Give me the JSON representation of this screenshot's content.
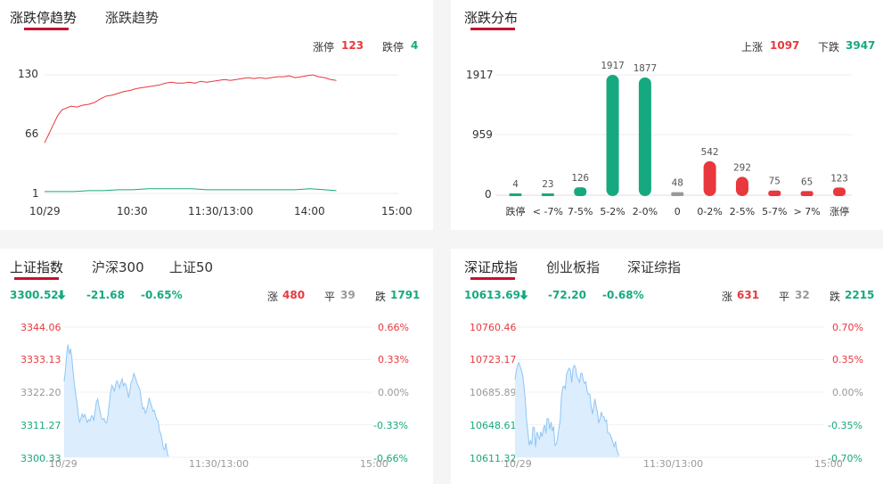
{
  "colors": {
    "up": "#e8383d",
    "down": "#16a97f",
    "flat": "#999999",
    "accent": "#c8102e",
    "area": "#dbeeff",
    "line": "#8fc6f5"
  },
  "limit_panel": {
    "tabs": [
      "涨跌停趋势",
      "涨跌趋势"
    ],
    "up_label": "涨停",
    "up_value": "123",
    "down_label": "跌停",
    "down_value": "4",
    "y_ticks": [
      "130",
      "66",
      "1"
    ],
    "x_ticks": [
      "10/29",
      "10:30",
      "11:30/13:00",
      "14:00",
      "15:00"
    ]
  },
  "dist_panel": {
    "tab": "涨跌分布",
    "up_label": "上涨",
    "up_value": "1097",
    "down_label": "下跌",
    "down_value": "3947",
    "y_ticks": [
      "1917",
      "959",
      "0"
    ]
  },
  "sh_panel": {
    "tabs": [
      "上证指数",
      "沪深300",
      "上证50"
    ],
    "price": "3300.52",
    "arrow_icon": "down-arrow-icon",
    "change": "-21.68",
    "pct": "-0.65%",
    "up_label": "涨",
    "up_value": "480",
    "flat_label": "平",
    "flat_value": "39",
    "down_label": "跌",
    "down_value": "1791",
    "y_left": [
      "3344.06",
      "3333.13",
      "3322.20",
      "3311.27",
      "3300.33"
    ],
    "y_right": [
      "0.66%",
      "0.33%",
      "0.00%",
      "-0.33%",
      "-0.66%"
    ],
    "x_ticks": [
      "10/29",
      "11:30/13:00",
      "15:00"
    ]
  },
  "sz_panel": {
    "tabs": [
      "深证成指",
      "创业板指",
      "深证综指"
    ],
    "price": "10613.69",
    "arrow_icon": "down-arrow-icon",
    "change": "-72.20",
    "pct": "-0.68%",
    "up_label": "涨",
    "up_value": "631",
    "flat_label": "平",
    "flat_value": "32",
    "down_label": "跌",
    "down_value": "2215",
    "y_left": [
      "10760.46",
      "10723.17",
      "10685.89",
      "10648.61",
      "10611.32"
    ],
    "y_right": [
      "0.70%",
      "0.35%",
      "0.00%",
      "-0.35%",
      "-0.70%"
    ],
    "x_ticks": [
      "10/29",
      "11:30/13:00",
      "15:00"
    ]
  },
  "chart_data": [
    {
      "type": "line",
      "name": "limit-trend",
      "y_range": [
        1,
        130
      ],
      "x_range": [
        0,
        240
      ],
      "series": [
        {
          "color": "#e8383d",
          "points": [
            [
              0,
              56
            ],
            [
              3,
              66
            ],
            [
              6,
              76
            ],
            [
              9,
              86
            ],
            [
              12,
              92
            ],
            [
              15,
              94
            ],
            [
              18,
              96
            ],
            [
              22,
              95
            ],
            [
              26,
              97
            ],
            [
              30,
              98
            ],
            [
              34,
              100
            ],
            [
              38,
              104
            ],
            [
              42,
              107
            ],
            [
              46,
              108
            ],
            [
              50,
              110
            ],
            [
              54,
              112
            ],
            [
              58,
              113
            ],
            [
              62,
              115
            ],
            [
              66,
              116
            ],
            [
              70,
              117
            ],
            [
              74,
              118
            ],
            [
              78,
              119
            ],
            [
              82,
              121
            ],
            [
              86,
              122
            ],
            [
              90,
              121
            ],
            [
              94,
              121
            ],
            [
              98,
              122
            ],
            [
              102,
              121
            ],
            [
              106,
              123
            ],
            [
              110,
              122
            ],
            [
              114,
              123
            ],
            [
              118,
              124
            ],
            [
              122,
              125
            ],
            [
              126,
              124
            ],
            [
              130,
              125
            ],
            [
              134,
              126
            ],
            [
              138,
              127
            ],
            [
              142,
              126
            ],
            [
              146,
              127
            ],
            [
              150,
              126
            ],
            [
              154,
              127
            ],
            [
              158,
              128
            ],
            [
              162,
              128
            ],
            [
              166,
              129
            ],
            [
              170,
              127
            ],
            [
              174,
              128
            ],
            [
              178,
              129
            ],
            [
              182,
              130
            ],
            [
              186,
              128
            ],
            [
              190,
              127
            ],
            [
              194,
              125
            ],
            [
              198,
              124
            ]
          ]
        },
        {
          "color": "#16a97f",
          "points": [
            [
              0,
              3
            ],
            [
              10,
              3
            ],
            [
              20,
              3
            ],
            [
              30,
              4
            ],
            [
              40,
              4
            ],
            [
              50,
              5
            ],
            [
              60,
              5
            ],
            [
              70,
              6
            ],
            [
              80,
              6
            ],
            [
              90,
              6
            ],
            [
              100,
              6
            ],
            [
              110,
              5
            ],
            [
              120,
              5
            ],
            [
              130,
              5
            ],
            [
              140,
              5
            ],
            [
              150,
              5
            ],
            [
              160,
              5
            ],
            [
              170,
              5
            ],
            [
              180,
              6
            ],
            [
              190,
              5
            ],
            [
              198,
              4
            ]
          ]
        }
      ]
    },
    {
      "type": "bar",
      "name": "change-distribution",
      "categories": [
        "跌停",
        "< -7%",
        "7-5%",
        "5-2%",
        "2-0%",
        "0",
        "0-2%",
        "2-5%",
        "5-7%",
        "> 7%",
        "涨停"
      ],
      "values": [
        4,
        23,
        126,
        1917,
        1877,
        48,
        542,
        292,
        75,
        65,
        123
      ],
      "colors": [
        "#16a97f",
        "#16a97f",
        "#16a97f",
        "#16a97f",
        "#16a97f",
        "#999999",
        "#e8383d",
        "#e8383d",
        "#e8383d",
        "#e8383d",
        "#e8383d"
      ],
      "ylim": [
        0,
        1917
      ]
    },
    {
      "type": "area",
      "name": "sh-index-intraday",
      "ylim": [
        3300.33,
        3344.06
      ],
      "x_range": [
        0,
        240
      ],
      "values": [
        3325.8,
        3329.5,
        3335.1,
        3338.2,
        3335.0,
        3336.8,
        3333.5,
        3329.0,
        3324.6,
        3321.5,
        3318.4,
        3314.6,
        3312.2,
        3313.4,
        3314.9,
        3313.8,
        3314.7,
        3313.3,
        3312.1,
        3313.0,
        3312.5,
        3314.1,
        3314.3,
        3312.6,
        3315.8,
        3318.8,
        3319.9,
        3317.6,
        3315.5,
        3313.5,
        3312.9,
        3313.4,
        3312.0,
        3311.9,
        3314.5,
        3318.3,
        3322.0,
        3324.5,
        3323.8,
        3322.4,
        3324.9,
        3326.0,
        3325.1,
        3323.6,
        3325.4,
        3326.7,
        3324.3,
        3325.2,
        3324.6,
        3322.9,
        3320.4,
        3322.6,
        3325.6,
        3326.3,
        3328.5,
        3327.6,
        3326.0,
        3324.8,
        3323.9,
        3322.8,
        3319.1,
        3316.6,
        3317.0,
        3315.2,
        3316.1,
        3318.0,
        3320.3,
        3318.7,
        3317.3,
        3315.8,
        3316.1,
        3314.2,
        3312.9,
        3312.6,
        3309.2,
        3308.3,
        3306.2,
        3303.4,
        3302.9,
        3305.1,
        3301.8,
        3300.5
      ]
    },
    {
      "type": "area",
      "name": "sz-index-intraday",
      "ylim": [
        10611.32,
        10760.46
      ],
      "x_range": [
        0,
        240
      ],
      "values": [
        10700.5,
        10710.3,
        10716.5,
        10719.8,
        10715.2,
        10711.0,
        10705.1,
        10692.4,
        10676.2,
        10653.9,
        10640.5,
        10625.0,
        10630.3,
        10625.8,
        10645.9,
        10645.0,
        10623.0,
        10640.2,
        10636.1,
        10632.3,
        10640.4,
        10634.8,
        10644.1,
        10648.4,
        10638.6,
        10655.9,
        10655.0,
        10643.4,
        10651.9,
        10641.1,
        10647.0,
        10625.0,
        10626.5,
        10632.7,
        10644.3,
        10652.7,
        10679.6,
        10691.4,
        10692.9,
        10689.8,
        10706.7,
        10710.3,
        10713.5,
        10711.6,
        10696.9,
        10713.2,
        10716.6,
        10714.3,
        10704.3,
        10701.4,
        10696.8,
        10707.1,
        10707.5,
        10699.8,
        10696.0,
        10697.8,
        10686.9,
        10683.4,
        10683.7,
        10671.3,
        10660.9,
        10668.3,
        10678.4,
        10669.6,
        10663.4,
        10650.5,
        10655.8,
        10663.3,
        10658.1,
        10657.7,
        10652.4,
        10654.0,
        10639.1,
        10638.9,
        10636.9,
        10633.0,
        10628.1,
        10623.5,
        10629.6,
        10620.3,
        10615.4,
        10613.7
      ]
    }
  ]
}
